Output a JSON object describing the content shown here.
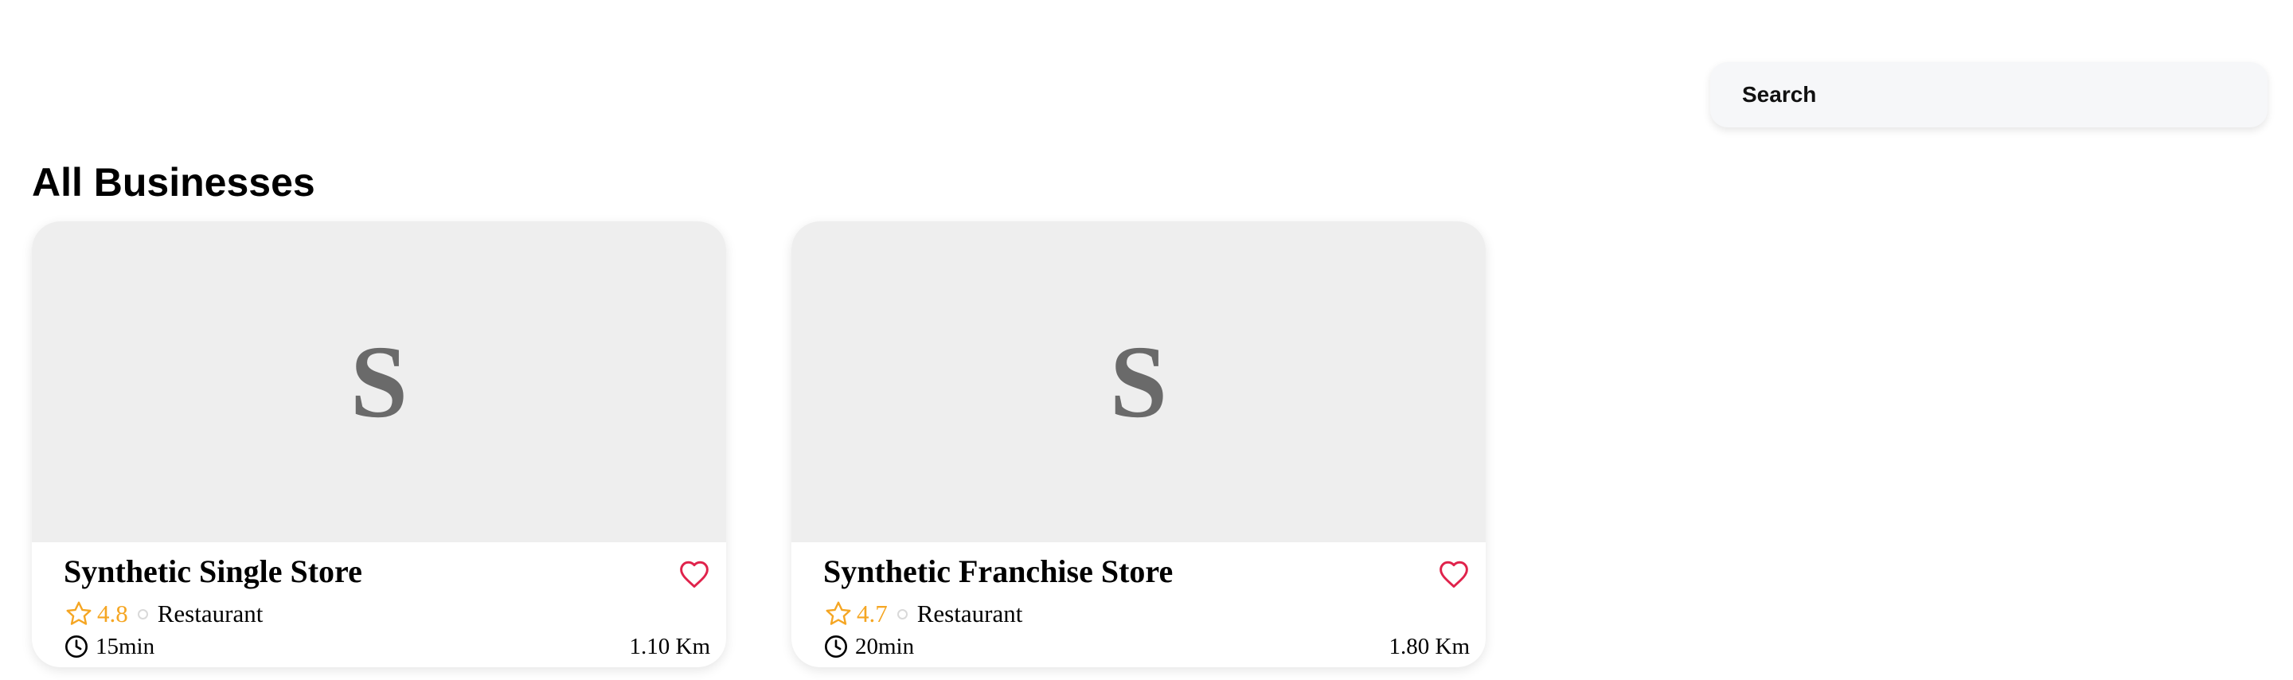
{
  "search": {
    "placeholder": "Search",
    "value": ""
  },
  "section": {
    "title": "All Businesses"
  },
  "businesses": [
    {
      "image_letter": "S",
      "name": "Synthetic Single Store",
      "rating": "4.8",
      "category": "Restaurant",
      "time": "15min",
      "distance": "1.10 Km"
    },
    {
      "image_letter": "S",
      "name": "Synthetic Franchise Store",
      "rating": "4.7",
      "category": "Restaurant",
      "time": "20min",
      "distance": "1.80 Km"
    }
  ],
  "icons": {
    "favorite": "heart-outline-icon",
    "rating": "star-outline-icon",
    "time": "clock-icon"
  },
  "colors": {
    "rating": "#f5a623",
    "favorite": "#e0224b",
    "image_placeholder_bg": "#eeeeee",
    "search_bg": "#f6f7f9"
  }
}
